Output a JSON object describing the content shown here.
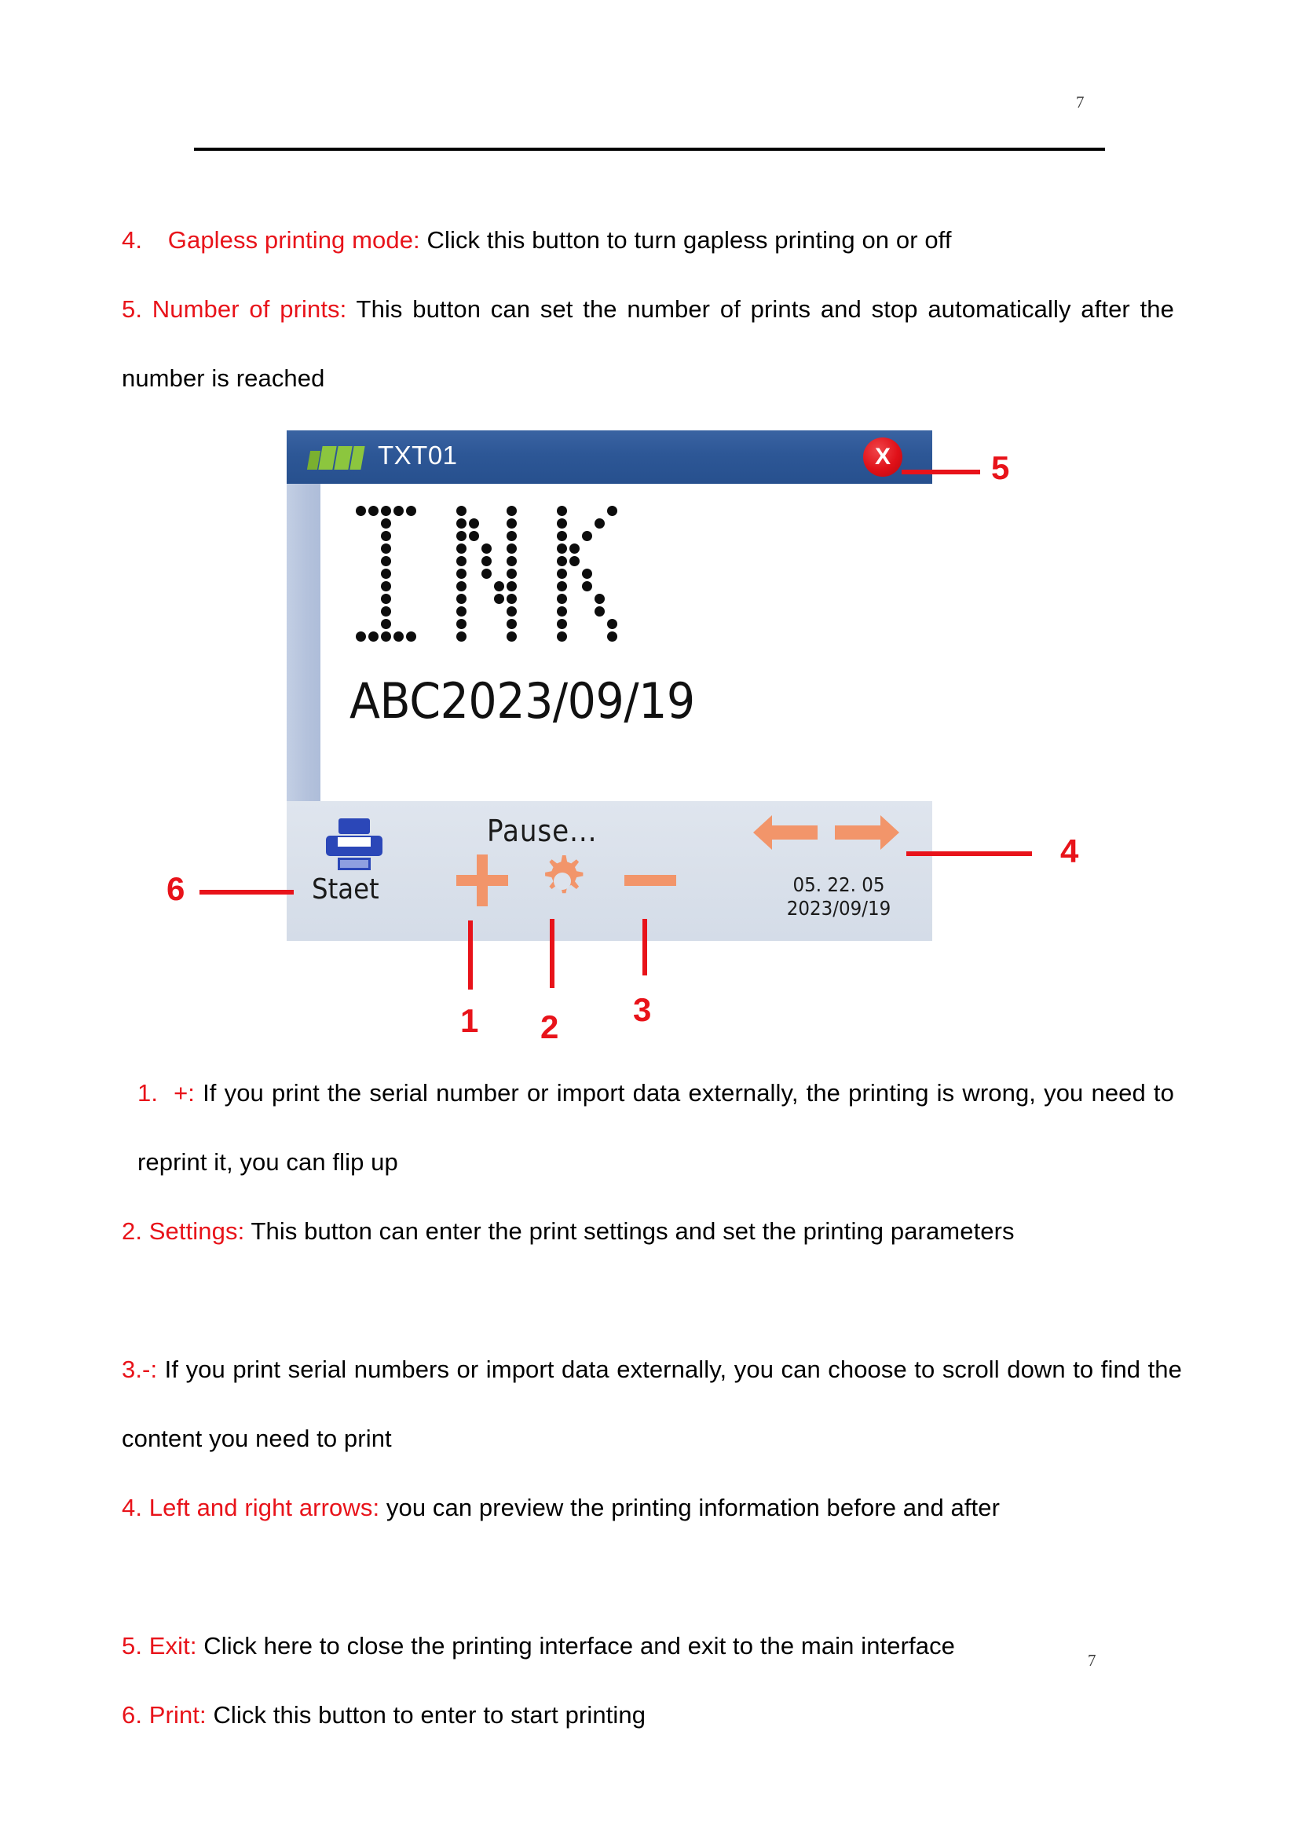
{
  "document": {
    "page_number_top": "7",
    "page_number_bottom": "7"
  },
  "paragraphs": {
    "item4_num": "4.",
    "item4_term": "Gapless printing mode:",
    "item4_text": " Click this button to turn gapless printing on or off",
    "item5_term": "5. Number of prints:",
    "item5_text": " This button can set the number of prints and stop automatically after the number is reached",
    "list1_num": "1.",
    "list1_term": "+:",
    "list1_text": " If you print the serial number or import data externally, the printing is wrong, you need to reprint it, you can flip up",
    "list2_term": "2. Settings:",
    "list2_text": " This button can enter the print settings and set the printing parameters",
    "list3_term": "3.-:",
    "list3_text": " If you print serial numbers or import data externally, you can choose to scroll down to find the content you need to print",
    "list4_term": "4. Left and right arrows:",
    "list4_text": " you can preview the printing information before and after",
    "list5_term": "5. Exit:",
    "list5_text": " Click here to close the printing interface and exit to the main interface",
    "list6_term": "6. Print:",
    "list6_text": " Click this button to enter to start printing"
  },
  "device": {
    "titlebar": {
      "battery_icon": "battery-signal-icon",
      "title": "TXT01",
      "close_label": "X"
    },
    "display": {
      "dot_matrix_text": "INK",
      "sub_text": "ABC2023/09/19"
    },
    "toolbar": {
      "print_icon": "printer-icon",
      "print_label": "Staet",
      "status": "Pause...",
      "plus_icon": "plus-icon",
      "gear_icon": "gear-settings-icon",
      "minus_icon": "minus-icon",
      "arrows_icon": "left-right-arrows-icon",
      "time": "05. 22. 05",
      "date": "2023/09/19"
    }
  },
  "callouts": {
    "c1": "1",
    "c2": "2",
    "c3": "3",
    "c4": "4",
    "c5": "5",
    "c6": "6"
  },
  "colors": {
    "accent_red": "#e8131a",
    "titlebar_blue": "#2d5796",
    "icon_orange": "#f2956a",
    "printer_blue": "#2b47b8",
    "battery_green": "#8cc63e",
    "rail_blue": "#b6c4de",
    "toolbar_bg": "#dde3ec"
  }
}
